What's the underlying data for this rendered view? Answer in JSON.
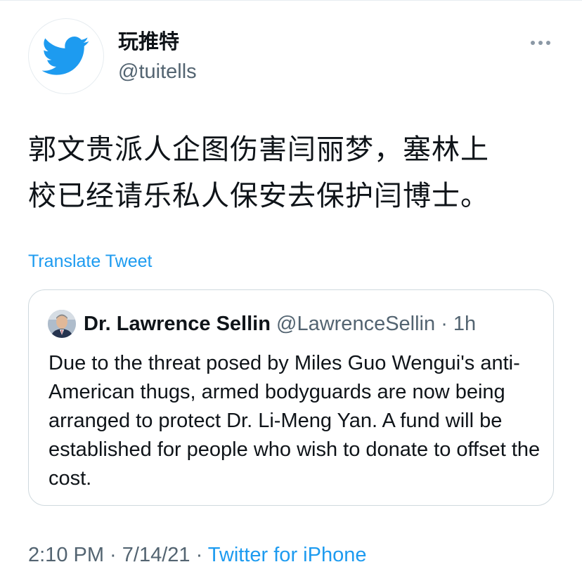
{
  "author": {
    "display_name": "玩推特",
    "handle": "@tuitells",
    "avatar_icon": "twitter-bird-icon",
    "brand_color": "#1d9bf0"
  },
  "more_icon": "ellipsis-icon",
  "tweet": {
    "text_line1": "郭文贵派人企图伤害闫丽梦，塞林上",
    "text_line2": "校已经请乐私人保安去保护闫博士。",
    "translate_label": "Translate Tweet"
  },
  "quoted": {
    "display_name": "Dr. Lawrence Sellin",
    "handle": "@LawrenceSellin",
    "separator": "·",
    "age": "1h",
    "text": "Due to the threat posed by Miles Guo Wengui's anti-American thugs, armed bodyguards are now being arranged to protect Dr. Li-Meng Yan. A fund will be established for people who wish to donate to offset the cost."
  },
  "footer": {
    "time": "2:10 PM",
    "separator1": " · ",
    "date": "7/14/21",
    "separator2": " · ",
    "source": "Twitter for iPhone"
  }
}
